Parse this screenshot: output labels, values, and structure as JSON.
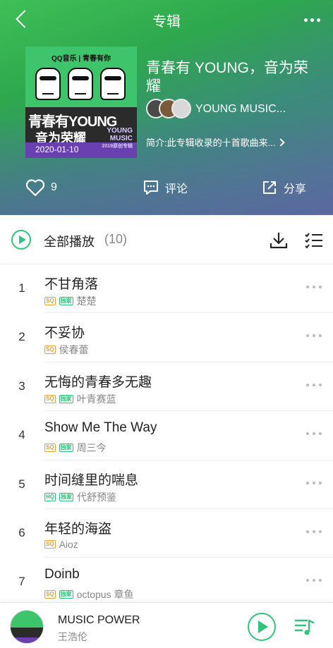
{
  "header": {
    "title": "专辑",
    "back_icon": "chevron-left-icon",
    "more_icon": "more-dots-icon"
  },
  "album": {
    "title": "青春有 YOUNG，音为荣耀",
    "artist": "YOUNG MUSIC...",
    "intro": "简介:此专辑收录的十首歌曲来...",
    "cover": {
      "top_text": "QQ音乐 | 青春有你",
      "title_line1": "青春有YOUNG",
      "title_line2": "音为荣耀",
      "badge_line1": "YOUNG",
      "badge_line2": "MUSIC",
      "badge_line3": "2019原创专辑",
      "date": "2020-01-10"
    }
  },
  "actions": {
    "like_count": "9",
    "comment_label": "评论",
    "share_label": "分享"
  },
  "playall": {
    "label": "全部播放",
    "count": "(10)"
  },
  "songs": [
    {
      "num": "1",
      "title": "不甘角落",
      "quality": "SQ",
      "exclusive": "独家",
      "artist": "楚楚"
    },
    {
      "num": "2",
      "title": "不妥协",
      "quality": "SQ",
      "exclusive": "",
      "artist": "侯春蕾"
    },
    {
      "num": "3",
      "title": "无悔的青春多无趣",
      "quality": "SQ",
      "exclusive": "独家",
      "artist": "叶青赛蓝"
    },
    {
      "num": "4",
      "title": "Show Me The Way",
      "quality": "SQ",
      "exclusive": "独家",
      "artist": "周三今"
    },
    {
      "num": "5",
      "title": "时间缝里的喘息",
      "quality": "HQ",
      "exclusive": "独家",
      "artist": "代舒预鉴"
    },
    {
      "num": "6",
      "title": "年轻的海盗",
      "quality": "SQ",
      "exclusive": "",
      "artist": "Aioz"
    },
    {
      "num": "7",
      "title": "Doinb",
      "quality": "SQ",
      "exclusive": "独家",
      "artist": "octopus 章鱼"
    }
  ],
  "player": {
    "title": "MUSIC POWER",
    "artist": "王浩伦"
  },
  "colors": {
    "accent": "#31c27c",
    "sq_tag": "#e6a23c"
  }
}
